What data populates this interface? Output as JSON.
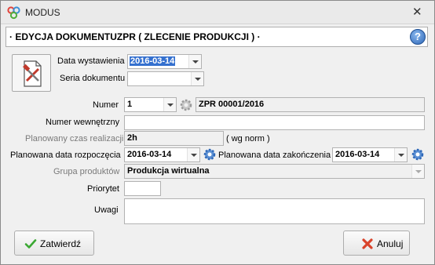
{
  "window": {
    "title": "MODUS",
    "close_glyph": "✕"
  },
  "header": {
    "title": "· EDYCJA DOKUMENTUZPR ( ZLECENIE PRODUKCJI ) ·",
    "help_glyph": "?"
  },
  "form": {
    "data_wystawienia": {
      "label": "Data wystawienia",
      "value": "2016-03-14"
    },
    "seria_dokumentu": {
      "label": "Seria dokumentu",
      "value": ""
    },
    "numer": {
      "label": "Numer",
      "value": "1",
      "number_text": "ZPR 00001/2016"
    },
    "numer_wewnetrzny": {
      "label": "Numer wewnętrzny",
      "value": ""
    },
    "planowany_czas": {
      "label": "Planowany czas realizacji",
      "value": "2h",
      "suffix": "( wg norm )"
    },
    "planowana_data_rozpoczecia": {
      "label": "Planowana data rozpoczęcia",
      "value": "2016-03-14"
    },
    "planowana_data_zakonczenia": {
      "label": "Planowana data zakończenia",
      "value": "2016-03-14"
    },
    "grupa_produktow": {
      "label": "Grupa produktów",
      "value": "Produkcja wirtualna"
    },
    "priorytet": {
      "label": "Priorytet",
      "value": ""
    },
    "uwagi": {
      "label": "Uwagi",
      "value": ""
    }
  },
  "buttons": {
    "confirm": "Zatwierdź",
    "cancel": "Anuluj"
  },
  "icons": {
    "app": "modus-logo-icon",
    "document": "document-tools-icon",
    "gear": "gear-icon",
    "confirm": "checkmark-icon",
    "cancel": "cancel-x-icon",
    "help": "help-icon"
  },
  "colors": {
    "selection": "#3470cf",
    "gear_blue": "#2f68b8",
    "check_green": "#3aa832",
    "cancel_red": "#d9432b"
  }
}
